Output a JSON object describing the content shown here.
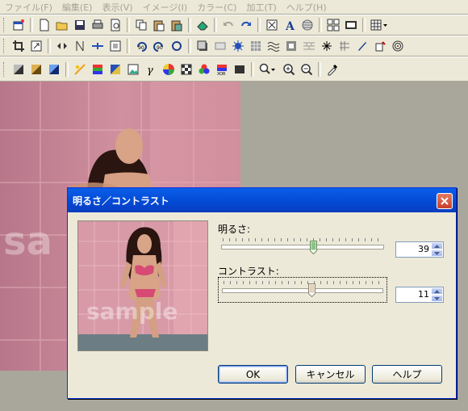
{
  "menu": [
    "ファイル(F)",
    "編集(E)",
    "表示(V)",
    "イメージ(I)",
    "カラー(C)",
    "加工(T)",
    "ヘルプ(H)"
  ],
  "watermark": {
    "canvas_text": "sa",
    "preview_text": "sample"
  },
  "dialog": {
    "title": "明るさ／コントラスト",
    "brightness_label": "明るさ:",
    "brightness_value": "39",
    "contrast_label": "コントラスト:",
    "contrast_value": "11",
    "ok_label": "OK",
    "cancel_label": "キャンセル",
    "help_label": "ヘルプ"
  },
  "colors": {
    "titlebar": "#0a5fea",
    "face": "#ece9d8",
    "photo_bg": "#c48d99"
  }
}
